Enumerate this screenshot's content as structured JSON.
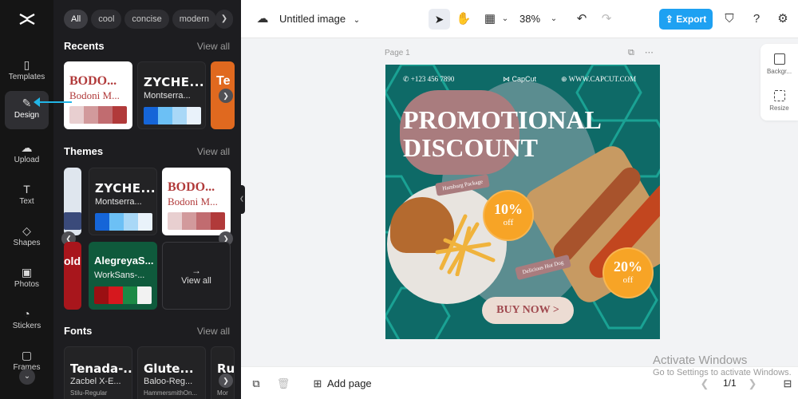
{
  "rail": {
    "items": [
      {
        "label": "Templates",
        "icon": "templates-icon"
      },
      {
        "label": "Design",
        "icon": "design-icon"
      },
      {
        "label": "Upload",
        "icon": "upload-icon"
      },
      {
        "label": "Text",
        "icon": "text-icon"
      },
      {
        "label": "Shapes",
        "icon": "shapes-icon"
      },
      {
        "label": "Photos",
        "icon": "photos-icon"
      },
      {
        "label": "Stickers",
        "icon": "stickers-icon"
      },
      {
        "label": "Frames",
        "icon": "frames-icon"
      }
    ]
  },
  "panel": {
    "chips": [
      "All",
      "cool",
      "concise",
      "modern"
    ],
    "recents": {
      "title": "Recents",
      "view_all": "View all",
      "cards": [
        {
          "t1": "BODO...",
          "t2": "Bodoni M..."
        },
        {
          "t1": "ZYCHE...",
          "t2": "Montserra..."
        },
        {
          "t1": "Te",
          "t2": ""
        }
      ]
    },
    "themes": {
      "title": "Themes",
      "view_all": "View all",
      "cards": [
        {
          "t1": "ZYCHE...",
          "t2": "Montserra..."
        },
        {
          "t1": "BODO...",
          "t2": "Bodoni M..."
        },
        {
          "t1": "old",
          "t2": ""
        },
        {
          "t1": "AlegreyaS...",
          "t2": "WorkSans-..."
        }
      ],
      "view_all_card": "View all"
    },
    "fonts": {
      "title": "Fonts",
      "view_all": "View all",
      "cards": [
        {
          "f1": "Tenada-...",
          "f2": "Zacbel X-E...",
          "f3": "Stilu-Regular"
        },
        {
          "f1": "Glute...",
          "f2": "Baloo-Reg...",
          "f3": "HammersmithOn..."
        },
        {
          "f1": "Ru",
          "f2": "",
          "f3": "Mor"
        }
      ]
    }
  },
  "topbar": {
    "title": "Untitled image",
    "zoom": "38%",
    "export": "Export"
  },
  "canvas": {
    "page_label": "Page 1",
    "design": {
      "phone": "+123 456 7890",
      "brand": "CapCut",
      "website": "WWW.CAPCUT.COM",
      "promo_line1": "PROMOTIONAL",
      "promo_line2": "DISCOUNT",
      "tag1": "Hamburg Package",
      "tag2": "Delicious Hot Dog",
      "badge1_value": "10%",
      "badge1_label": "off",
      "badge2_value": "20%",
      "badge2_label": "off",
      "buy": "BUY NOW >"
    }
  },
  "side_tools": [
    {
      "label": "Backgr..."
    },
    {
      "label": "Resize"
    }
  ],
  "bottombar": {
    "add_page": "Add page",
    "pager": "1/1"
  },
  "watermark": {
    "line1": "Activate Windows",
    "line2": "Go to Settings to activate Windows."
  },
  "colors": {
    "accent": "#1ea1f2",
    "rail_bg": "#151515",
    "panel_bg": "#1d1d20",
    "design_teal": "#0e6a67",
    "badge_orange": "#f7a426"
  }
}
